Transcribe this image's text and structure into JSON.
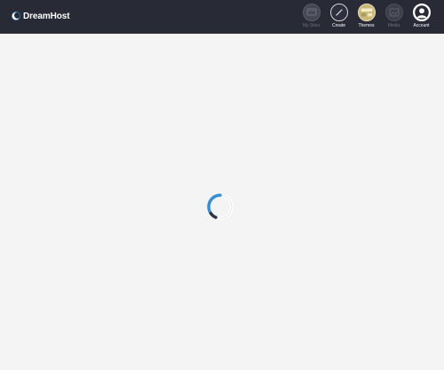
{
  "app": {
    "brand_name": "DreamHost"
  },
  "nav": {
    "items": [
      {
        "label": "My Sites",
        "icon": "sites-icon",
        "enabled": false
      },
      {
        "label": "Create",
        "icon": "create-icon",
        "enabled": true
      },
      {
        "label": "Themes",
        "icon": "themes-icon",
        "enabled": true
      },
      {
        "label": "Media",
        "icon": "media-icon",
        "enabled": false
      },
      {
        "label": "Account",
        "icon": "account-icon",
        "enabled": true
      }
    ]
  },
  "colors": {
    "topbar": "#282a36",
    "background": "#f4f4f4",
    "spinner_accent": "#3a8fd0"
  },
  "status": {
    "loading_indicator": "spinner-icon"
  }
}
